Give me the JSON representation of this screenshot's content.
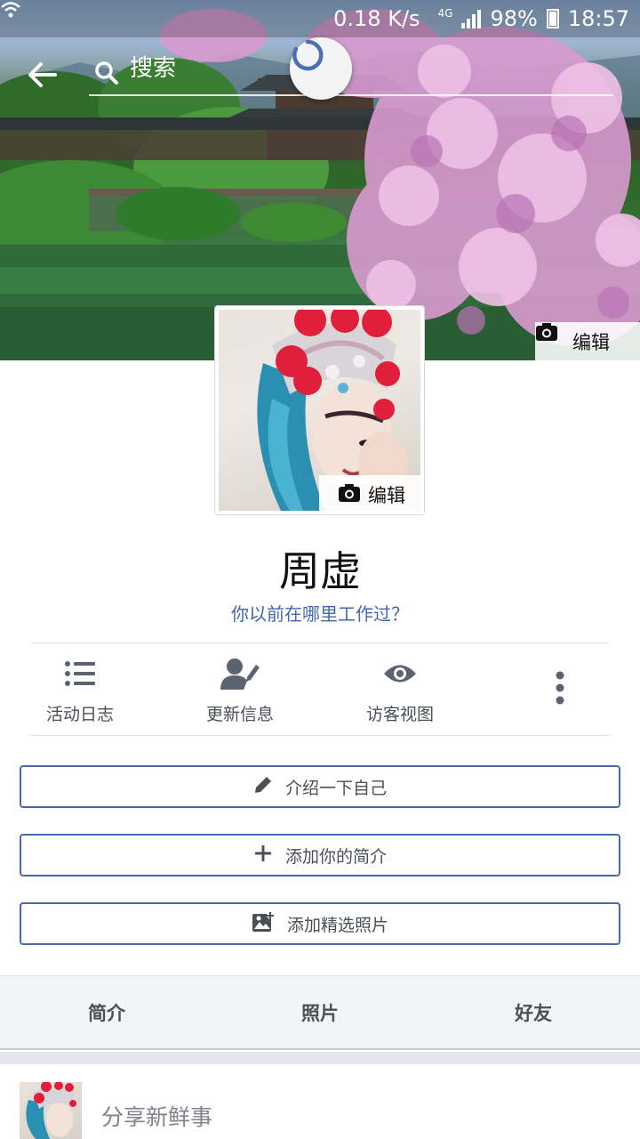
{
  "status_bar": {
    "speed": "0.18 K/s",
    "network": "4G",
    "battery": "98%",
    "time": "18:57"
  },
  "search": {
    "placeholder": "搜索"
  },
  "cover": {
    "edit_label": "编辑"
  },
  "avatar": {
    "edit_label": "编辑"
  },
  "profile": {
    "name": "周虚",
    "work_prompt": "你以前在哪里工作过？"
  },
  "actions": [
    {
      "label": "活动日志",
      "icon": "list-icon"
    },
    {
      "label": "更新信息",
      "icon": "user-edit-icon"
    },
    {
      "label": "访客视图",
      "icon": "eye-icon"
    },
    {
      "label": "",
      "icon": "more-vertical-icon"
    }
  ],
  "buttons": {
    "intro": "介绍一下自己",
    "add_bio": "添加你的简介",
    "add_photos": "添加精选照片"
  },
  "tabs": [
    "简介",
    "照片",
    "好友"
  ],
  "composer": {
    "prompt": "分享新鲜事"
  },
  "colors": {
    "accent": "#4267b2",
    "button_border": "#4a69a8",
    "text_secondary": "#4b4f56"
  }
}
